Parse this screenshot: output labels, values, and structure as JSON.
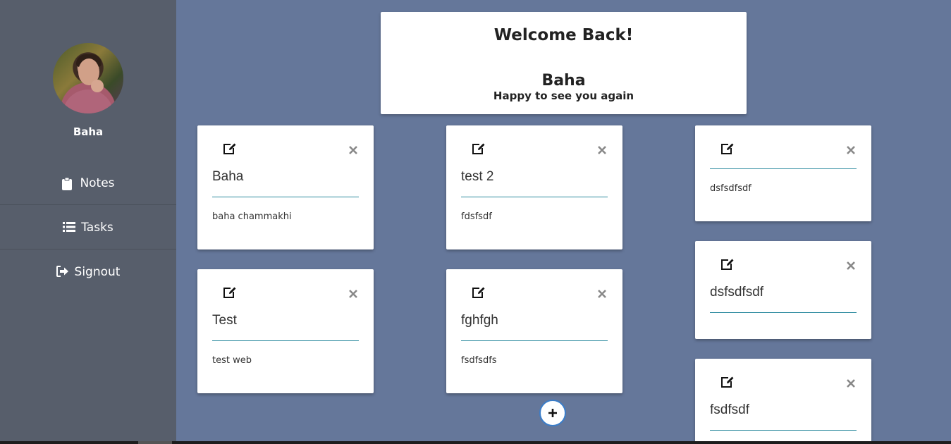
{
  "sidebar": {
    "username": "Baha",
    "nav": [
      {
        "label": "Notes",
        "icon": "clipboard-icon"
      },
      {
        "label": "Tasks",
        "icon": "list-icon"
      },
      {
        "label": "Signout",
        "icon": "signout-icon"
      }
    ]
  },
  "welcome": {
    "title": "Welcome Back!",
    "name": "Baha",
    "subtitle": "Happy to see you again"
  },
  "notes": [
    {
      "title": "Baha",
      "body": "baha chammakhi"
    },
    {
      "title": "test 2",
      "body": "fdsfsdf"
    },
    {
      "title": "",
      "body": "dsfsdfsdf"
    },
    {
      "title": "Test",
      "body": "test web"
    },
    {
      "title": "fghfgh",
      "body": "fsdfsdfs"
    },
    {
      "title": "dsfsdfsdf",
      "body": ""
    },
    {
      "title": "fsdfsdf",
      "body": ""
    }
  ],
  "colors": {
    "background": "#65779a",
    "sidebar": "#575e6b",
    "accent_line": "#2b8a9e",
    "add_button_border": "#3a7dc9"
  }
}
